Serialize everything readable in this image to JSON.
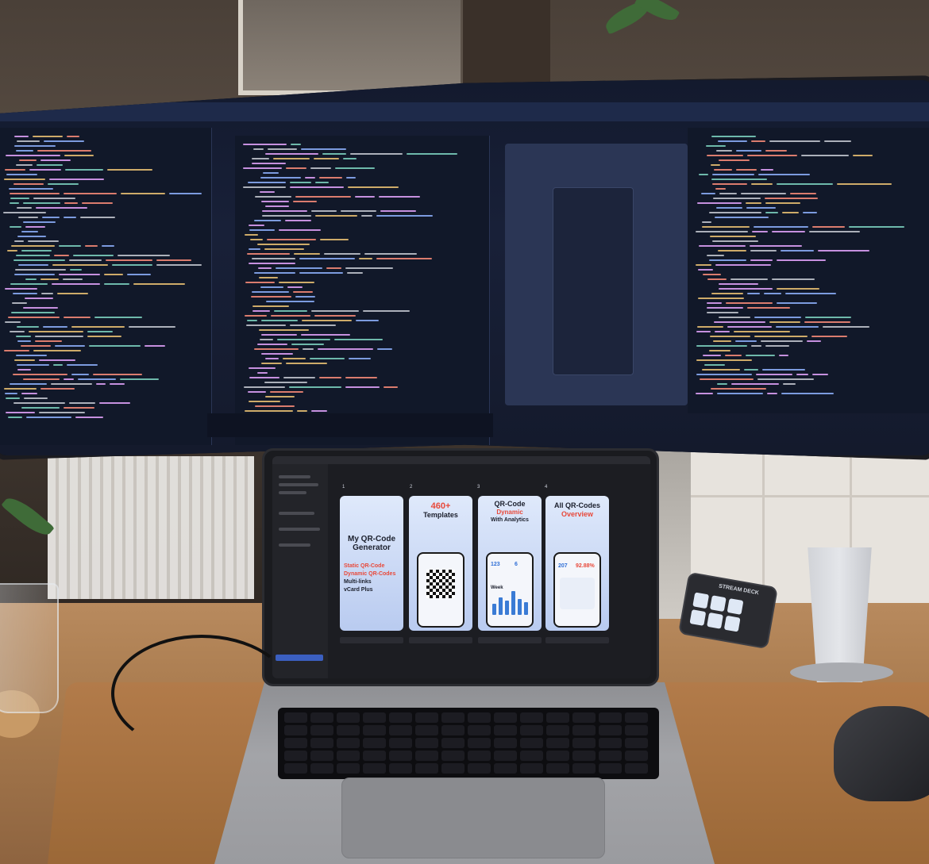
{
  "laptop_screen": {
    "cards": [
      {
        "number": "1",
        "title": "My QR-Code Generator",
        "lines": [
          "Static QR-Code",
          "Dynamic QR-Codes",
          "Multi-links",
          "vCard Plus"
        ]
      },
      {
        "number": "2",
        "title": "460+",
        "subtitle": "Templates"
      },
      {
        "number": "3",
        "title": "QR-Code",
        "subtitle": "Dynamic",
        "subtitle2": "With Analytics",
        "stats": [
          "123",
          "6"
        ],
        "chart_label": "Week"
      },
      {
        "number": "4",
        "title": "All QR-Codes",
        "subtitle": "Overview",
        "stats": [
          "207",
          "92.88%"
        ]
      }
    ]
  },
  "streamdeck": {
    "label": "STREAM DECK"
  },
  "colors": {
    "accent_red": "#e8493a",
    "accent_blue": "#2f6fd6",
    "card_bg": "#c9d8f5",
    "code_bg": "#111829"
  }
}
